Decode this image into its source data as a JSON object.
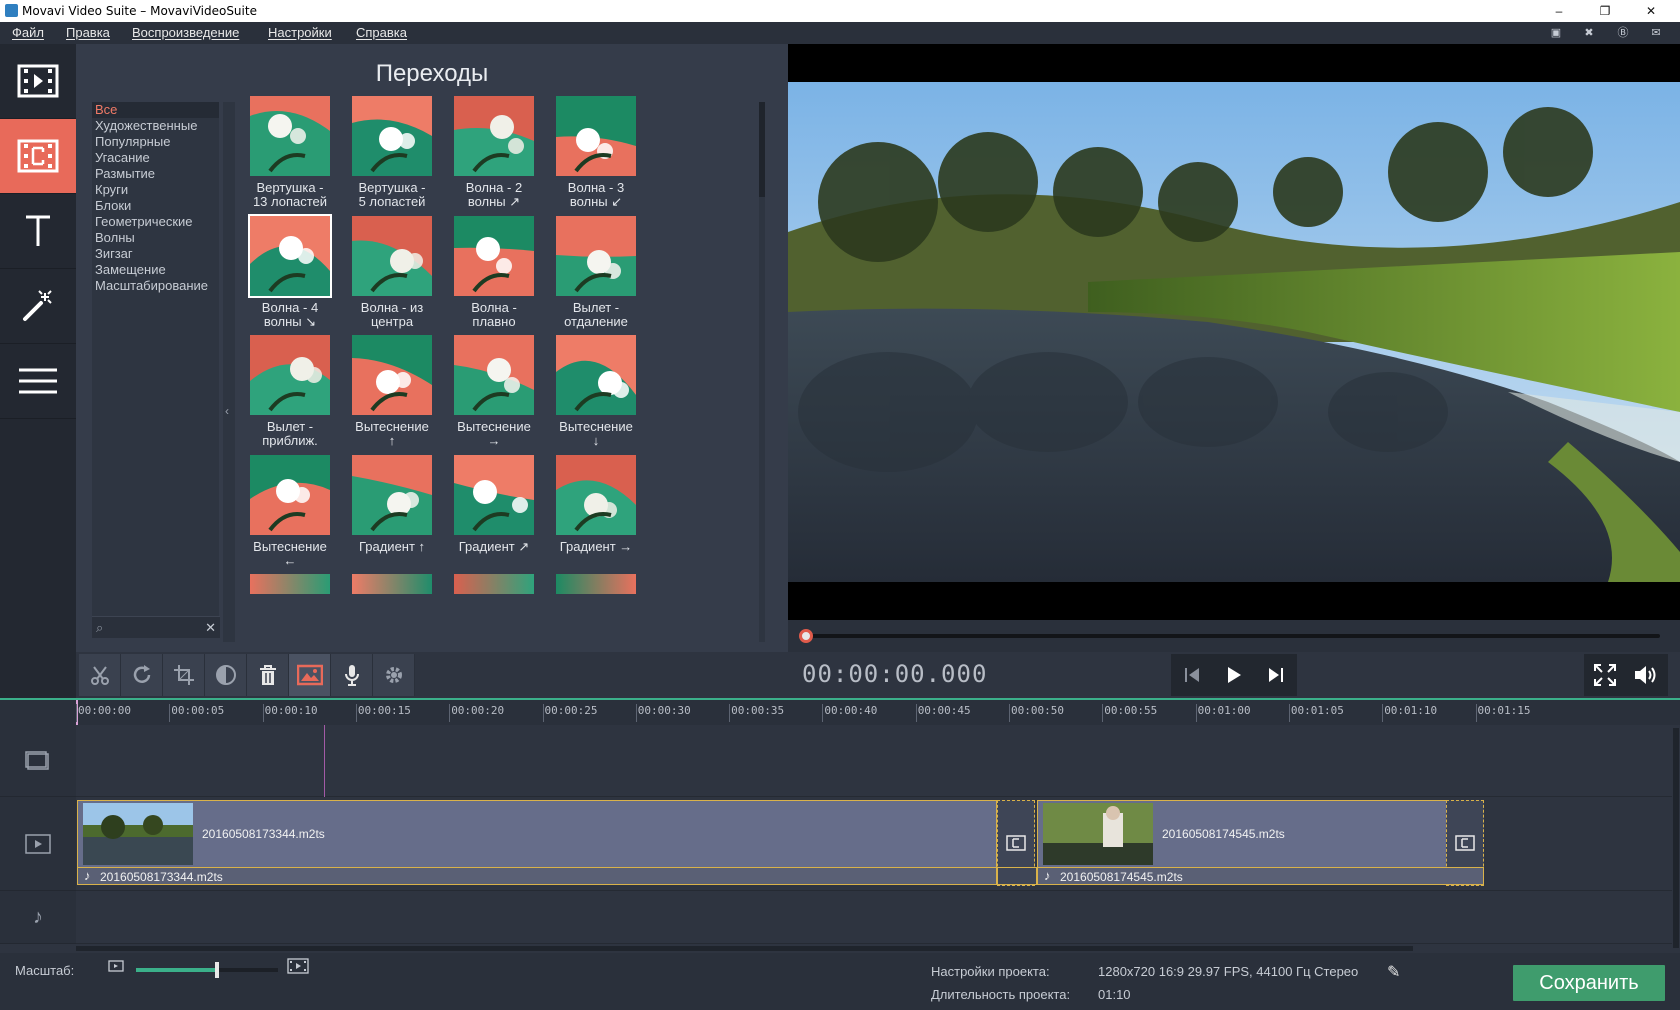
{
  "window": {
    "title": "Movavi Video Suite – MovaviVideoSuite",
    "minimize": "–",
    "restore": "❐",
    "close": "✕"
  },
  "menu": {
    "items": [
      "Файл",
      "Правка",
      "Воспроизведение",
      "Настройки",
      "Справка"
    ]
  },
  "sidebar": {
    "items": [
      {
        "name": "import",
        "icon": "film-import-icon"
      },
      {
        "name": "transitions",
        "icon": "transitions-icon",
        "active": true
      },
      {
        "name": "titles",
        "icon": "text-icon"
      },
      {
        "name": "filters",
        "icon": "magic-wand-icon"
      },
      {
        "name": "more",
        "icon": "menu-icon"
      }
    ]
  },
  "panel": {
    "title": "Переходы",
    "categories": [
      "Все",
      "Художественные",
      "Популярные",
      "Угасание",
      "Размытие",
      "Круги",
      "Блоки",
      "Геометрические",
      "Волны",
      "Зигзаг",
      "Замещение",
      "Масштабирование"
    ],
    "selected_category": "Все",
    "collapse_icon": "‹",
    "search_icon": "⌕",
    "clear_icon": "✕",
    "transitions": [
      {
        "line1": "Вертушка -",
        "line2": "13 лопастей"
      },
      {
        "line1": "Вертушка -",
        "line2": "5 лопастей"
      },
      {
        "line1": "Волна - 2",
        "line2": "волны ↗"
      },
      {
        "line1": "Волна - 3",
        "line2": "волны ↙"
      },
      {
        "line1": "Волна - 4",
        "line2": "волны ↘",
        "selected": true
      },
      {
        "line1": "Волна - из",
        "line2": "центра"
      },
      {
        "line1": "Волна -",
        "line2": "плавно"
      },
      {
        "line1": "Вылет -",
        "line2": "отдаление"
      },
      {
        "line1": "Вылет -",
        "line2": "приближ."
      },
      {
        "line1": "Вытеснение",
        "line2": "↑"
      },
      {
        "line1": "Вытеснение",
        "line2": "→"
      },
      {
        "line1": "Вытеснение",
        "line2": "↓"
      },
      {
        "line1": "Вытеснение",
        "line2": "←"
      },
      {
        "line1": "Градиент ↑",
        "line2": ""
      },
      {
        "line1": "Градиент ↗",
        "line2": ""
      },
      {
        "line1": "Градиент →",
        "line2": ""
      }
    ]
  },
  "toolbar": {
    "tools": [
      "scissors-icon",
      "rotate-icon",
      "crop-icon",
      "color-adjust-icon",
      "trash-icon",
      "image-icon",
      "microphone-icon",
      "gear-icon"
    ],
    "timecode": "00:00:00.000"
  },
  "playback": {
    "prev_icon": "skip-back-icon",
    "play_icon": "play-icon",
    "next_icon": "skip-forward-icon",
    "fullscreen_icon": "fullscreen-icon",
    "volume_icon": "volume-icon",
    "position_fraction": 0
  },
  "timeline": {
    "ticks": [
      "00:00:00",
      "00:00:05",
      "00:00:10",
      "00:00:15",
      "00:00:20",
      "00:00:25",
      "00:00:30",
      "00:00:35",
      "00:00:40",
      "00:00:45",
      "00:00:50",
      "00:00:55",
      "00:01:00",
      "00:01:05",
      "00:01:10",
      "00:01:15"
    ],
    "clips": [
      {
        "video_name": "20160508173344.m2ts",
        "audio_name": "20160508173344.m2ts"
      },
      {
        "video_name": "20160508174545.m2ts",
        "audio_name": "20160508174545.m2ts"
      }
    ],
    "audio_icon": "♪"
  },
  "bottom": {
    "zoom_label": "Масштаб:",
    "zoom_level": 0.57,
    "project_settings_label": "Настройки проекта:",
    "project_settings_value": "1280x720 16:9 29.97 FPS, 44100 Гц Стерео",
    "project_duration_label": "Длительность проекта:",
    "project_duration_value": "01:10",
    "edit_icon": "✎",
    "save_label": "Сохранить"
  },
  "colors": {
    "accent": "#e86a5a",
    "save": "#3f9c6d",
    "clip_border": "#d9b24a",
    "timeline_accent": "#3bb08a"
  }
}
